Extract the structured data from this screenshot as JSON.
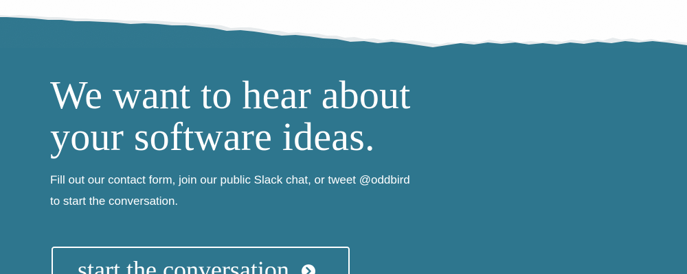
{
  "theme": {
    "background": "#2e768e",
    "paper": "#ffffff",
    "text": "#ffffff"
  },
  "cta": {
    "headline_line1": "We want to hear about",
    "headline_line2": "your software ideas.",
    "intro_line1": "Fill out our contact form, join our public Slack chat, or tweet @oddbird",
    "intro_line2": "to start the conversation.",
    "button_label": "start the conversation",
    "button_icon": "chevron-right-circle-icon"
  }
}
